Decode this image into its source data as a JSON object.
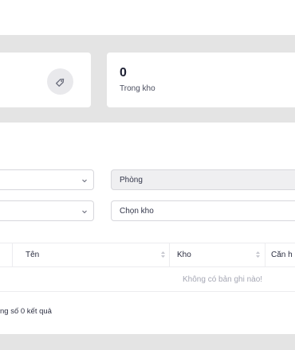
{
  "stats": {
    "right_value": "0",
    "right_label": "Trong kho",
    "left_icon": "tag-icon"
  },
  "filters": {
    "room_placeholder": "Phòng",
    "warehouse_placeholder": "Chọn kho"
  },
  "table": {
    "columns": [
      "Tên",
      "Kho",
      "Căn h"
    ],
    "empty_message": "Không có bản ghi nào!",
    "footer": "ng số 0 kết quả"
  }
}
